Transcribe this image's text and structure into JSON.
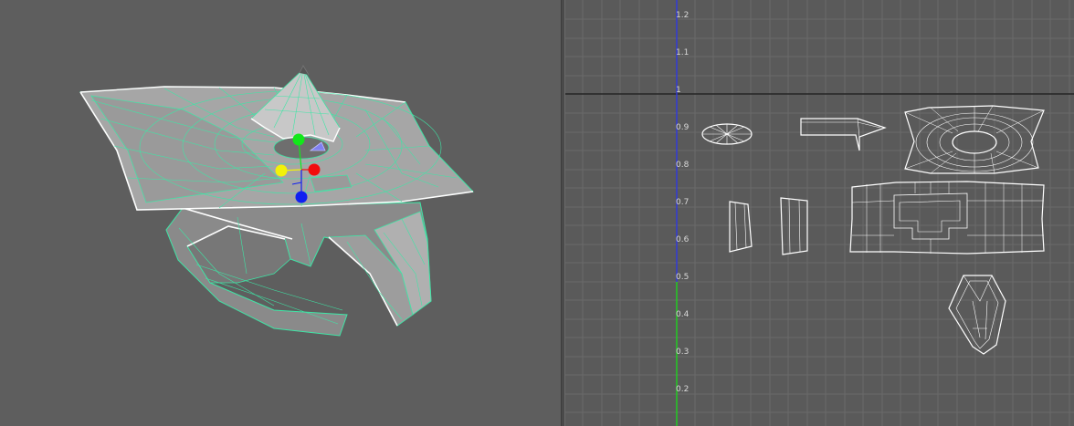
{
  "viewport_3d": {
    "name": "perspective-viewport",
    "manipulator": {
      "handles": [
        "green",
        "yellow",
        "red",
        "blue"
      ],
      "colors": {
        "green": "#12e81a",
        "yellow": "#f2f20a",
        "red": "#f20d0d",
        "blue": "#1020f0"
      }
    },
    "colors": {
      "wire": "#3ee6a6",
      "mesh_light": "#a8a8a8",
      "mesh_dark": "#7b7b7b"
    }
  },
  "uv_editor": {
    "name": "uv-texture-editor",
    "axis_labels": [
      "1.2",
      "1.1",
      "1",
      "0.9",
      "0.8",
      "0.7",
      "0.6",
      "0.5",
      "0.4",
      "0.3",
      "0.2"
    ],
    "colors": {
      "grid": "#6a6a6a",
      "v_axis_upper": "#2f38e0",
      "v_axis_lower": "#1fd31f",
      "uv_shell": "#ffffff",
      "boundary": "#1a1a1a"
    }
  }
}
